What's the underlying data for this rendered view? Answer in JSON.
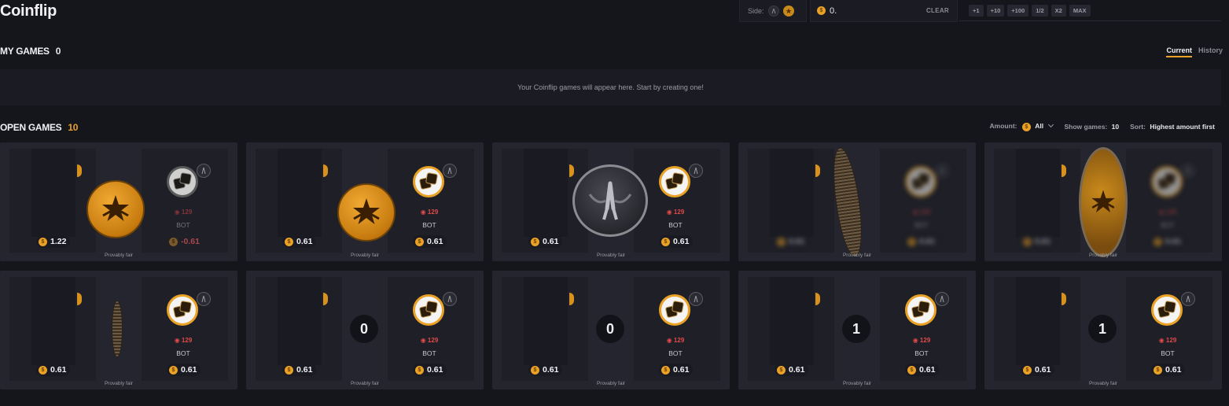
{
  "page_title": "Coinflip",
  "controls": {
    "side_label": "Side:",
    "amount_value": "0.",
    "clear_label": "CLEAR",
    "quick_buttons": [
      "+1",
      "+10",
      "+100",
      "1/2",
      "X2",
      "MAX"
    ]
  },
  "my_games": {
    "title": "MY GAMES",
    "count": "0",
    "tabs": [
      "Current",
      "History"
    ],
    "empty_message": "Your Coinflip games will appear here. Start by creating one!"
  },
  "open_games": {
    "title": "OPEN GAMES",
    "count": "10",
    "filters": {
      "amount_label": "Amount:",
      "amount_value": "All",
      "show_label": "Show games:",
      "show_value": "10",
      "sort_label": "Sort:",
      "sort_value": "Highest amount first"
    },
    "games": [
      {
        "left_amount": "1.22",
        "right_amount": "-0.61",
        "level": "129",
        "name": "BOT",
        "fair": "Provably fair"
      },
      {
        "left_amount": "0.61",
        "right_amount": "0.61",
        "level": "129",
        "name": "BOT",
        "fair": "Provably fair"
      },
      {
        "left_amount": "0.61",
        "right_amount": "0.61",
        "level": "129",
        "name": "BOT",
        "fair": "Provably fair"
      },
      {
        "left_amount": "0.61",
        "right_amount": "0.61",
        "level": "129",
        "name": "BOT",
        "fair": "Provably fair"
      },
      {
        "left_amount": "0.61",
        "right_amount": "0.61",
        "level": "129",
        "name": "BOT",
        "fair": "Provably fair"
      },
      {
        "left_amount": "0.61",
        "right_amount": "0.61",
        "level": "129",
        "name": "BOT",
        "fair": "Provably fair"
      },
      {
        "left_amount": "0.61",
        "right_amount": "0.61",
        "level": "129",
        "name": "BOT",
        "fair": "Provably fair",
        "countdown": "0"
      },
      {
        "left_amount": "0.61",
        "right_amount": "0.61",
        "level": "129",
        "name": "BOT",
        "fair": "Provably fair",
        "countdown": "0"
      },
      {
        "left_amount": "0.61",
        "right_amount": "0.61",
        "level": "129",
        "name": "BOT",
        "fair": "Provably fair",
        "countdown": "1"
      },
      {
        "left_amount": "0.61",
        "right_amount": "0.61",
        "level": "129",
        "name": "BOT",
        "fair": "Provably fair",
        "countdown": "1"
      }
    ]
  },
  "colors": {
    "accent": "#e9a126",
    "background": "#15161c",
    "card": "#24252e",
    "level": "#e24a4a"
  }
}
